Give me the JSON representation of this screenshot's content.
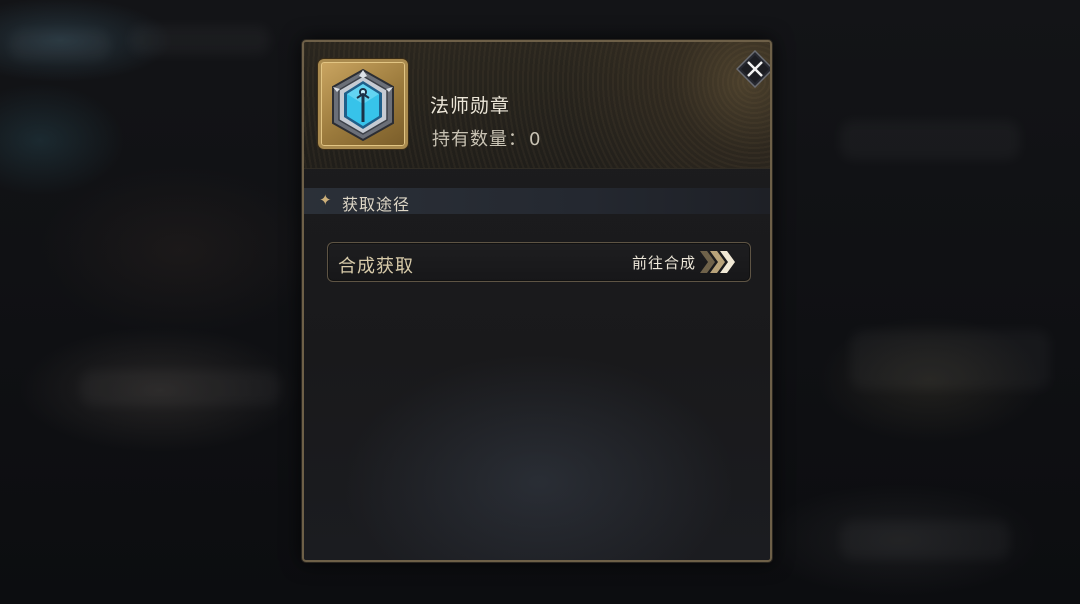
{
  "item": {
    "name": "法师勋章",
    "count_label": "持有数量：",
    "count_value": "0",
    "icon": "mage-medal-icon"
  },
  "section": {
    "title": "获取途径",
    "icon": "sparkle-star-icon"
  },
  "sources": [
    {
      "label": "合成获取",
      "action_label": "前往合成",
      "action_icon": "triple-chevron-right-icon"
    }
  ],
  "close_icon": "close-x-icon",
  "colors": {
    "frame_gold": "#a98a4e",
    "gem_blue": "#37c3ea",
    "accent_gold": "#cdb07a"
  }
}
